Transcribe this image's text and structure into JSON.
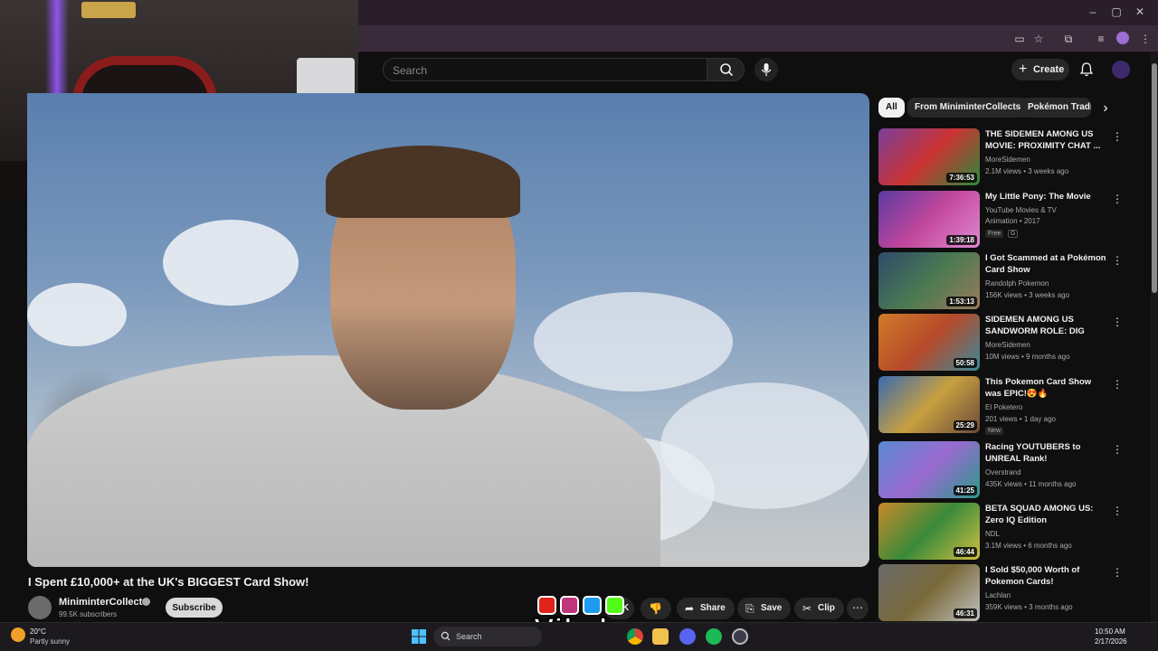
{
  "search": {
    "placeholder": "Search"
  },
  "header": {
    "create_label": "Create"
  },
  "video": {
    "title": "I Spent £10,000+ at the UK's BIGGEST Card Show!",
    "channel": "MiniminterCollects",
    "subscribers": "99.5K subscribers",
    "subscribe_label": "Subscribe",
    "like_count": "K",
    "share_label": "Share",
    "save_label": "Save",
    "clip_label": "Clip"
  },
  "watermark": {
    "text": "Vibzlo"
  },
  "chips": [
    "All",
    "From MiniminterCollects",
    "Pokémon Tradi"
  ],
  "recommendations": [
    {
      "title": "THE SIDEMEN AMONG US MOVIE: PROXIMITY CHAT ...",
      "channel": "MoreSidemen",
      "meta": "2.1M views • 3 weeks ago",
      "duration": "7:36:53",
      "thumb_color": "#7a3f9a"
    },
    {
      "title": "My Little Pony: The Movie",
      "channel": "YouTube Movies & TV",
      "meta": "Animation • 2017",
      "duration": "1:39:18",
      "badge": "Free",
      "badge2": "G",
      "thumb_color": "#c2479c"
    },
    {
      "title": "I Got Scammed at a Pokémon Card Show",
      "channel": "Randolph Pokemon",
      "meta": "156K views • 3 weeks ago",
      "duration": "1:53:13",
      "thumb_color": "#4a7a52"
    },
    {
      "title": "SIDEMEN AMONG US SANDWORM ROLE: DIG UNDE...",
      "channel": "MoreSidemen",
      "meta": "10M views • 9 months ago",
      "duration": "50:58",
      "thumb_color": "#b64a2a"
    },
    {
      "title": "This Pokemon Card Show was EPIC!😍🔥",
      "channel": "El Poketero",
      "meta": "201 views • 1 day ago",
      "duration": "25:29",
      "badge": "New",
      "thumb_color": "#c8a040"
    },
    {
      "title": "Racing YOUTUBERS to UNREAL Rank!",
      "channel": "Overstrand",
      "meta": "435K views • 11 months ago",
      "duration": "41:25",
      "thumb_color": "#5a8ad0"
    },
    {
      "title": "BETA SQUAD AMONG US: Zero IQ Edition",
      "channel": "NDL",
      "meta": "3.1M views • 6 months ago",
      "duration": "46:44",
      "thumb_color": "#3a8a3a"
    },
    {
      "title": "I Sold $50,000 Worth of Pokemon Cards!",
      "channel": "Lachlan",
      "meta": "359K views • 3 months ago",
      "duration": "46:31",
      "thumb_color": "#7a6a3a"
    }
  ],
  "taskbar": {
    "temp": "20°C",
    "weather": "Partly sunny",
    "search_label": "Search",
    "time": "10:50 AM",
    "date": "2/17/2026"
  },
  "colors": {
    "accent": "#f1f1f1",
    "background": "#0f0f0f",
    "chrome": "#3a2b3b"
  }
}
